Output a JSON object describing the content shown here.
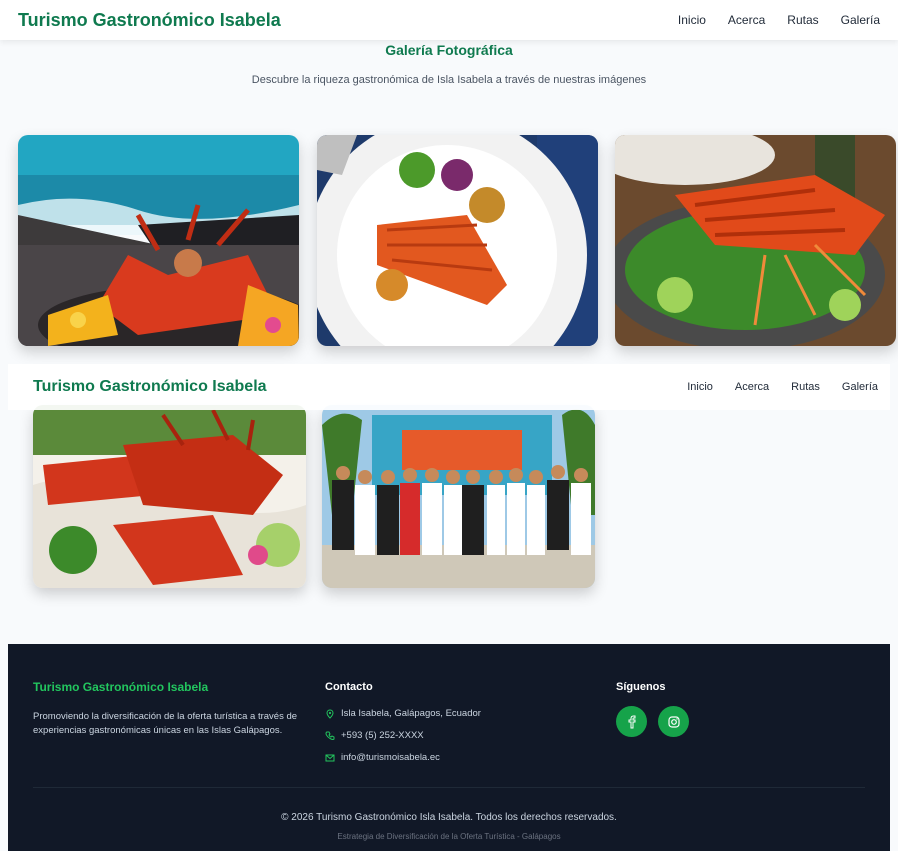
{
  "nav": {
    "brand": "Turismo Gastronómico Isabela",
    "links": [
      "Inicio",
      "Acerca",
      "Rutas",
      "Galería"
    ]
  },
  "gallery": {
    "title": "Galería Fotográfica",
    "subtitle": "Descubre la riqueza gastronómica de Isla Isabela a través de nuestras imágenes",
    "images": [
      "lobster-platter-sea-photo",
      "lobster-tail-plate-photo",
      "lobster-salad-photo",
      "lobster-feast-photo",
      "festival-group-photo"
    ]
  },
  "footer": {
    "brand": "Turismo Gastronómico Isabela",
    "description": "Promoviendo la diversificación de la oferta turística a través de experiencias gastronómicas únicas en las Islas Galápagos.",
    "contact_title": "Contacto",
    "address": "Isla Isabela, Galápagos, Ecuador",
    "phone": "+593 (5) 252-XXXX",
    "email": "info@turismoisabela.ec",
    "social_title": "Síguenos",
    "copyright": "© 2026 Turismo Gastronómico Isla Isabela. Todos los derechos reservados.",
    "strategy": "Estrategia de Diversificación de la Oferta Turística - Galápagos"
  },
  "colors": {
    "brand_green": "#0f7a4f",
    "accent_green": "#16a34a",
    "footer_bg": "#111827"
  }
}
